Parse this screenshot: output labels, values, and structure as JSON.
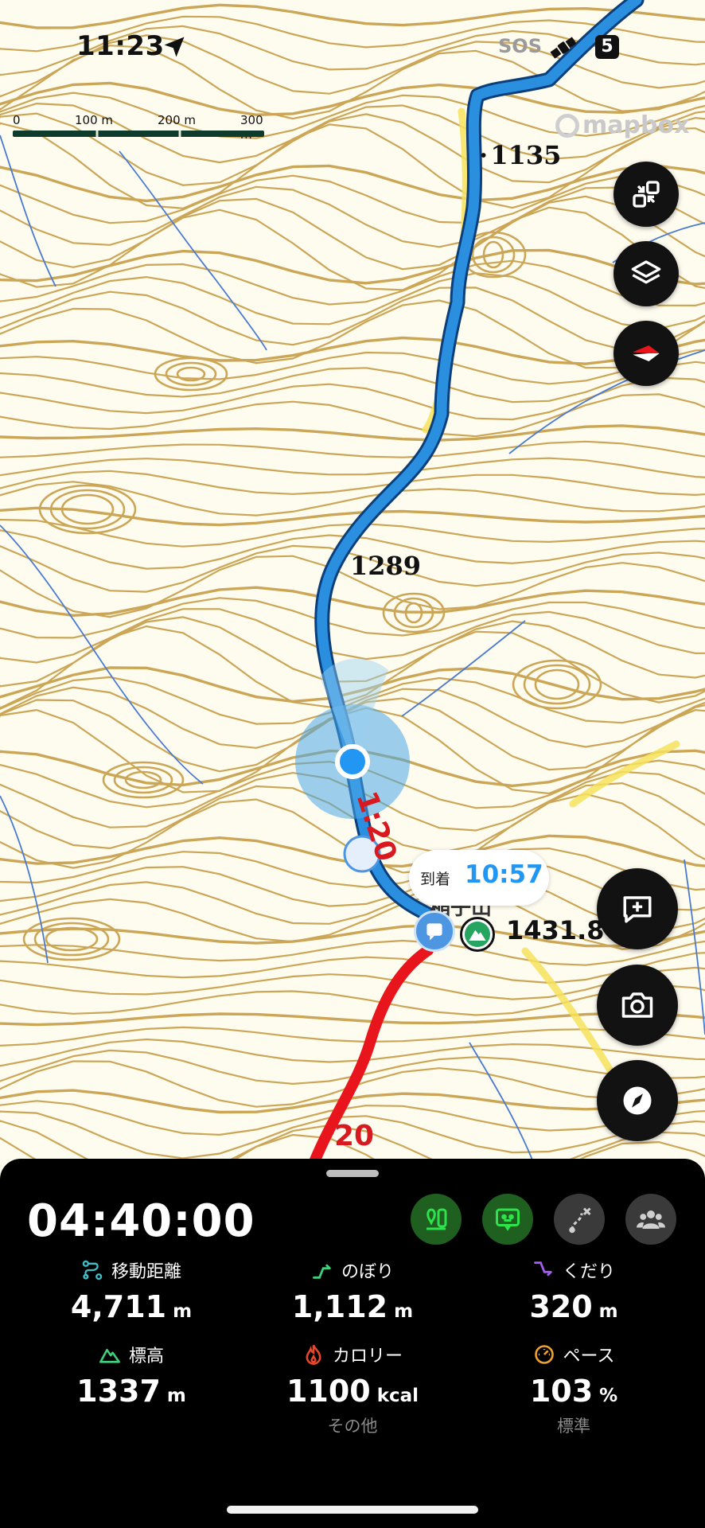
{
  "status_bar": {
    "time": "11:23",
    "sos": "SOS",
    "network": "5"
  },
  "map": {
    "scale_labels": [
      "0",
      "100 m",
      "200 m",
      "300 m"
    ],
    "attribution": "mapbox",
    "peak_labels": [
      "1135",
      "1289",
      "1431.8"
    ],
    "summit_name": "稲子山",
    "route_ring_labels": [
      "20",
      "20"
    ],
    "route_time_label": "1:20",
    "arrival_label": "到着",
    "arrival_time": "10:57",
    "colors": {
      "route_blue": "#2b8fe0",
      "route_red": "#e8161c",
      "contour": "#c9a24e",
      "stream": "#4a7ad0"
    },
    "icons": [
      "fullscreen-exit-icon",
      "layers-icon",
      "compass-rose-icon",
      "add-memo-icon",
      "camera-icon",
      "navigation-compass-icon"
    ]
  },
  "panel": {
    "elapsed_time": "04:40:00",
    "buttons": [
      "map-pin-icon",
      "robot-face-icon",
      "route-deviation-icon",
      "group-icon"
    ],
    "stats": [
      {
        "label": "移動距離",
        "value": "4,711",
        "unit": "m",
        "icon": "distance-icon",
        "color": "#3fbfc7"
      },
      {
        "label": "のぼり",
        "value": "1,112",
        "unit": "m",
        "icon": "ascent-icon",
        "color": "#3fd07a"
      },
      {
        "label": "くだり",
        "value": "320",
        "unit": "m",
        "icon": "descent-icon",
        "color": "#a25df0"
      },
      {
        "label": "標高",
        "value": "1337",
        "unit": "m",
        "icon": "elevation-icon",
        "color": "#3fd07a"
      },
      {
        "label": "カロリー",
        "value": "1100",
        "unit": "kcal",
        "icon": "calorie-icon",
        "color": "#e8472c",
        "sub": "その他"
      },
      {
        "label": "ペース",
        "value": "103",
        "unit": "%",
        "icon": "pace-icon",
        "color": "#f0a22c",
        "sub": "標準"
      }
    ]
  }
}
